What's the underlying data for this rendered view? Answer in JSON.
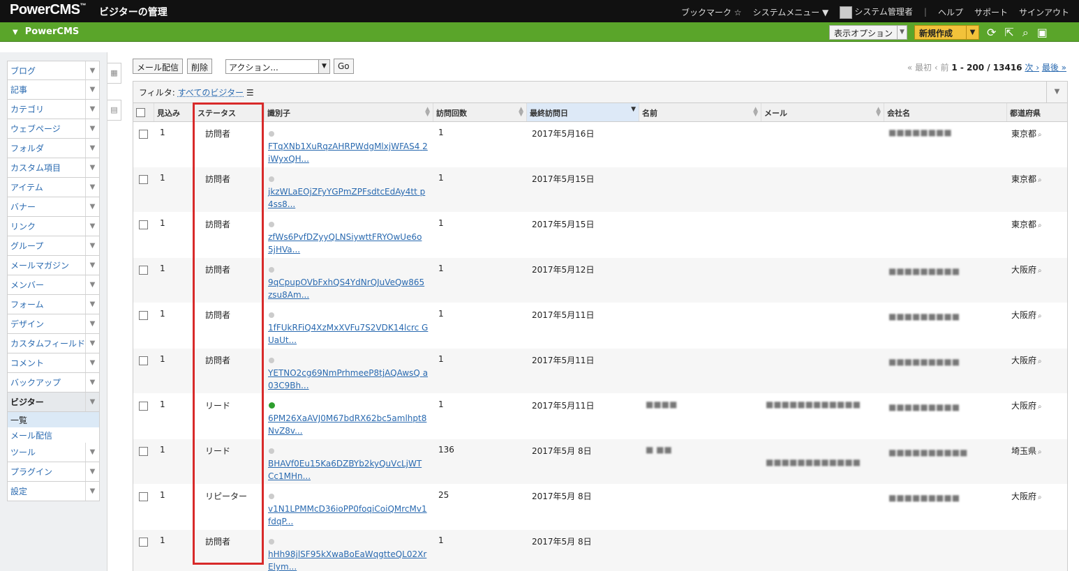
{
  "app": {
    "brand": "PowerCMS",
    "brand_tm": "™",
    "page_heading": "ビジターの管理"
  },
  "topnav": {
    "bookmark": "ブックマーク",
    "system_menu": "システムメニュー ▼",
    "user": "システム管理者",
    "help": "ヘルプ",
    "support": "サポート",
    "signout": "サインアウト"
  },
  "greenbar": {
    "site": "PowerCMS",
    "view_options": "表示オプション",
    "new": "新規作成"
  },
  "sidebar": {
    "items": [
      "ブログ",
      "記事",
      "カテゴリ",
      "ウェブページ",
      "フォルダ",
      "カスタム項目",
      "アイテム",
      "バナー",
      "リンク",
      "グループ",
      "メールマガジン",
      "メンバー",
      "フォーム",
      "デザイン",
      "カスタムフィールド",
      "コメント",
      "バックアップ"
    ],
    "active": "ビジター",
    "subitems": [
      "一覧",
      "メール配信"
    ],
    "after": [
      "ツール",
      "プラグイン",
      "設定"
    ]
  },
  "toolbar": {
    "mail": "メール配信",
    "delete": "削除",
    "action": "アクション...",
    "go": "Go"
  },
  "pager": {
    "first": "« 最初",
    "prev": "‹ 前",
    "range": "1 - 200 / 13416",
    "next": "次 ›",
    "last": "最後 »"
  },
  "filter": {
    "label": "フィルタ:",
    "value": "すべてのビジター"
  },
  "columns": {
    "prospect": "見込み",
    "status": "ステータス",
    "identifier": "識別子",
    "visits": "訪問回数",
    "last_visit": "最終訪問日",
    "name": "名前",
    "email": "メール",
    "company": "会社名",
    "prefecture": "都道府県"
  },
  "rows": [
    {
      "prospect": "1",
      "status": "訪問者",
      "id1": "FTqXNb1XuRqzAHRPWdgMlxjWFAS4",
      "id2": "2iWyxQH...",
      "visits": "1",
      "date": "2017年5月16日",
      "name": "",
      "email": "",
      "company": "■■■■■■■■",
      "pref": "東京都",
      "lead": false
    },
    {
      "prospect": "1",
      "status": "訪問者",
      "id1": "jkzWLaEOjZFyYGPmZPFsdtcEdAy4tt",
      "id2": "p4ss8...",
      "visits": "1",
      "date": "2017年5月15日",
      "name": "",
      "email": "",
      "company": "",
      "pref": "東京都",
      "lead": false
    },
    {
      "prospect": "1",
      "status": "訪問者",
      "id1": "zfWs6PvfDZyyQLNSiywttFRYOwUe6o",
      "id2": "5jHVa...",
      "visits": "1",
      "date": "2017年5月15日",
      "name": "",
      "email": "",
      "company": "",
      "pref": "東京都",
      "lead": false
    },
    {
      "prospect": "1",
      "status": "訪問者",
      "id1": "9qCpupOVbFxhQS4YdNrQJuVeQw865",
      "id2": "zsu8Am...",
      "visits": "1",
      "date": "2017年5月12日",
      "name": "",
      "email": "",
      "company": "■■■■■■■■■",
      "pref": "大阪府",
      "lead": false
    },
    {
      "prospect": "1",
      "status": "訪問者",
      "id1": "1fFUkRFiQ4XzMxXVFu7S2VDK14lcrc",
      "id2": "GUaUt...",
      "visits": "1",
      "date": "2017年5月11日",
      "name": "",
      "email": "",
      "company": "■■■■■■■■■",
      "pref": "大阪府",
      "lead": false
    },
    {
      "prospect": "1",
      "status": "訪問者",
      "id1": "YETNO2cg69NmPrhmeeP8tjAQAwsQ",
      "id2": "a03C9Bh...",
      "visits": "1",
      "date": "2017年5月11日",
      "name": "",
      "email": "",
      "company": "■■■■■■■■■",
      "pref": "大阪府",
      "lead": false
    },
    {
      "prospect": "1",
      "status": "リード",
      "id1": "6PM26XaAVJ0M67bdRX62bc5amlhpt8",
      "id2": "NvZ8v...",
      "visits": "1",
      "date": "2017年5月11日",
      "name": "■■■■",
      "email": "■■■■■■■■■■■■",
      "company": "■■■■■■■■■",
      "pref": "大阪府",
      "lead": true
    },
    {
      "prospect": "1",
      "status": "リード",
      "id1": "BHAVf0Eu15Ka6DZBYb2kyQuVcLjWT",
      "id2": "Cc1MHn...",
      "visits": "136",
      "date": "2017年5月 8日",
      "name": "■ ■■",
      "email": "■■■■■■■■■■■■",
      "company": "■■■■■■■■■■",
      "pref": "埼玉県",
      "lead": false
    },
    {
      "prospect": "1",
      "status": "リピーター",
      "id1": "v1N1LPMMcD36ioPP0foqiCoiQMrcMv1",
      "id2": "fdqP...",
      "visits": "25",
      "date": "2017年5月 8日",
      "name": "",
      "email": "",
      "company": "■■■■■■■■■",
      "pref": "大阪府",
      "lead": false
    },
    {
      "prospect": "1",
      "status": "訪問者",
      "id1": "hHh98jlSF95kXwaBoEaWqgtteQL02Xr",
      "id2": "Elym...",
      "visits": "1",
      "date": "2017年5月 8日",
      "name": "",
      "email": "",
      "company": "",
      "pref": "",
      "lead": false
    }
  ]
}
